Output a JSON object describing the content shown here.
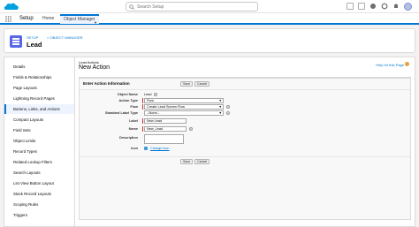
{
  "topbar": {
    "search_placeholder": "Search Setup"
  },
  "nav": {
    "app_name": "Setup",
    "tabs": [
      {
        "label": "Home"
      },
      {
        "label": "Object Manager"
      }
    ]
  },
  "header": {
    "breadcrumb_1": "SETUP",
    "breadcrumb_2": "OBJECT MANAGER",
    "title": "Lead"
  },
  "sidebar": {
    "items": [
      {
        "label": "Details"
      },
      {
        "label": "Fields & Relationships"
      },
      {
        "label": "Page Layouts"
      },
      {
        "label": "Lightning Record Pages"
      },
      {
        "label": "Buttons, Links, and Actions"
      },
      {
        "label": "Compact Layouts"
      },
      {
        "label": "Field Sets"
      },
      {
        "label": "Object Limits"
      },
      {
        "label": "Record Types"
      },
      {
        "label": "Related Lookup Filters"
      },
      {
        "label": "Search Layouts"
      },
      {
        "label": "List View Button Layout"
      },
      {
        "label": "Stack Record Layouts"
      },
      {
        "label": "Scoping Rules"
      },
      {
        "label": "Triggers"
      }
    ],
    "active_index": 4
  },
  "content": {
    "subtitle": "Lead Actions",
    "title": "New Action",
    "help_link": "Help for this Page"
  },
  "form": {
    "panel_title": "Enter Action Information",
    "save_label": "Save",
    "cancel_label": "Cancel",
    "fields": {
      "object_name": {
        "label": "Object Name",
        "value": "Lead"
      },
      "action_type": {
        "label": "Action Type",
        "value": "Flow"
      },
      "flow": {
        "label": "Flow",
        "value": "Create Lead Screen Flow"
      },
      "standard_label_type": {
        "label": "Standard Label Type",
        "value": "--None--"
      },
      "label": {
        "label": "Label",
        "value": "New Lead"
      },
      "name": {
        "label": "Name",
        "value": "New_Lead"
      },
      "description": {
        "label": "Description",
        "value": ""
      },
      "icon": {
        "label": "Icon",
        "link": "Change Icon"
      }
    }
  }
}
